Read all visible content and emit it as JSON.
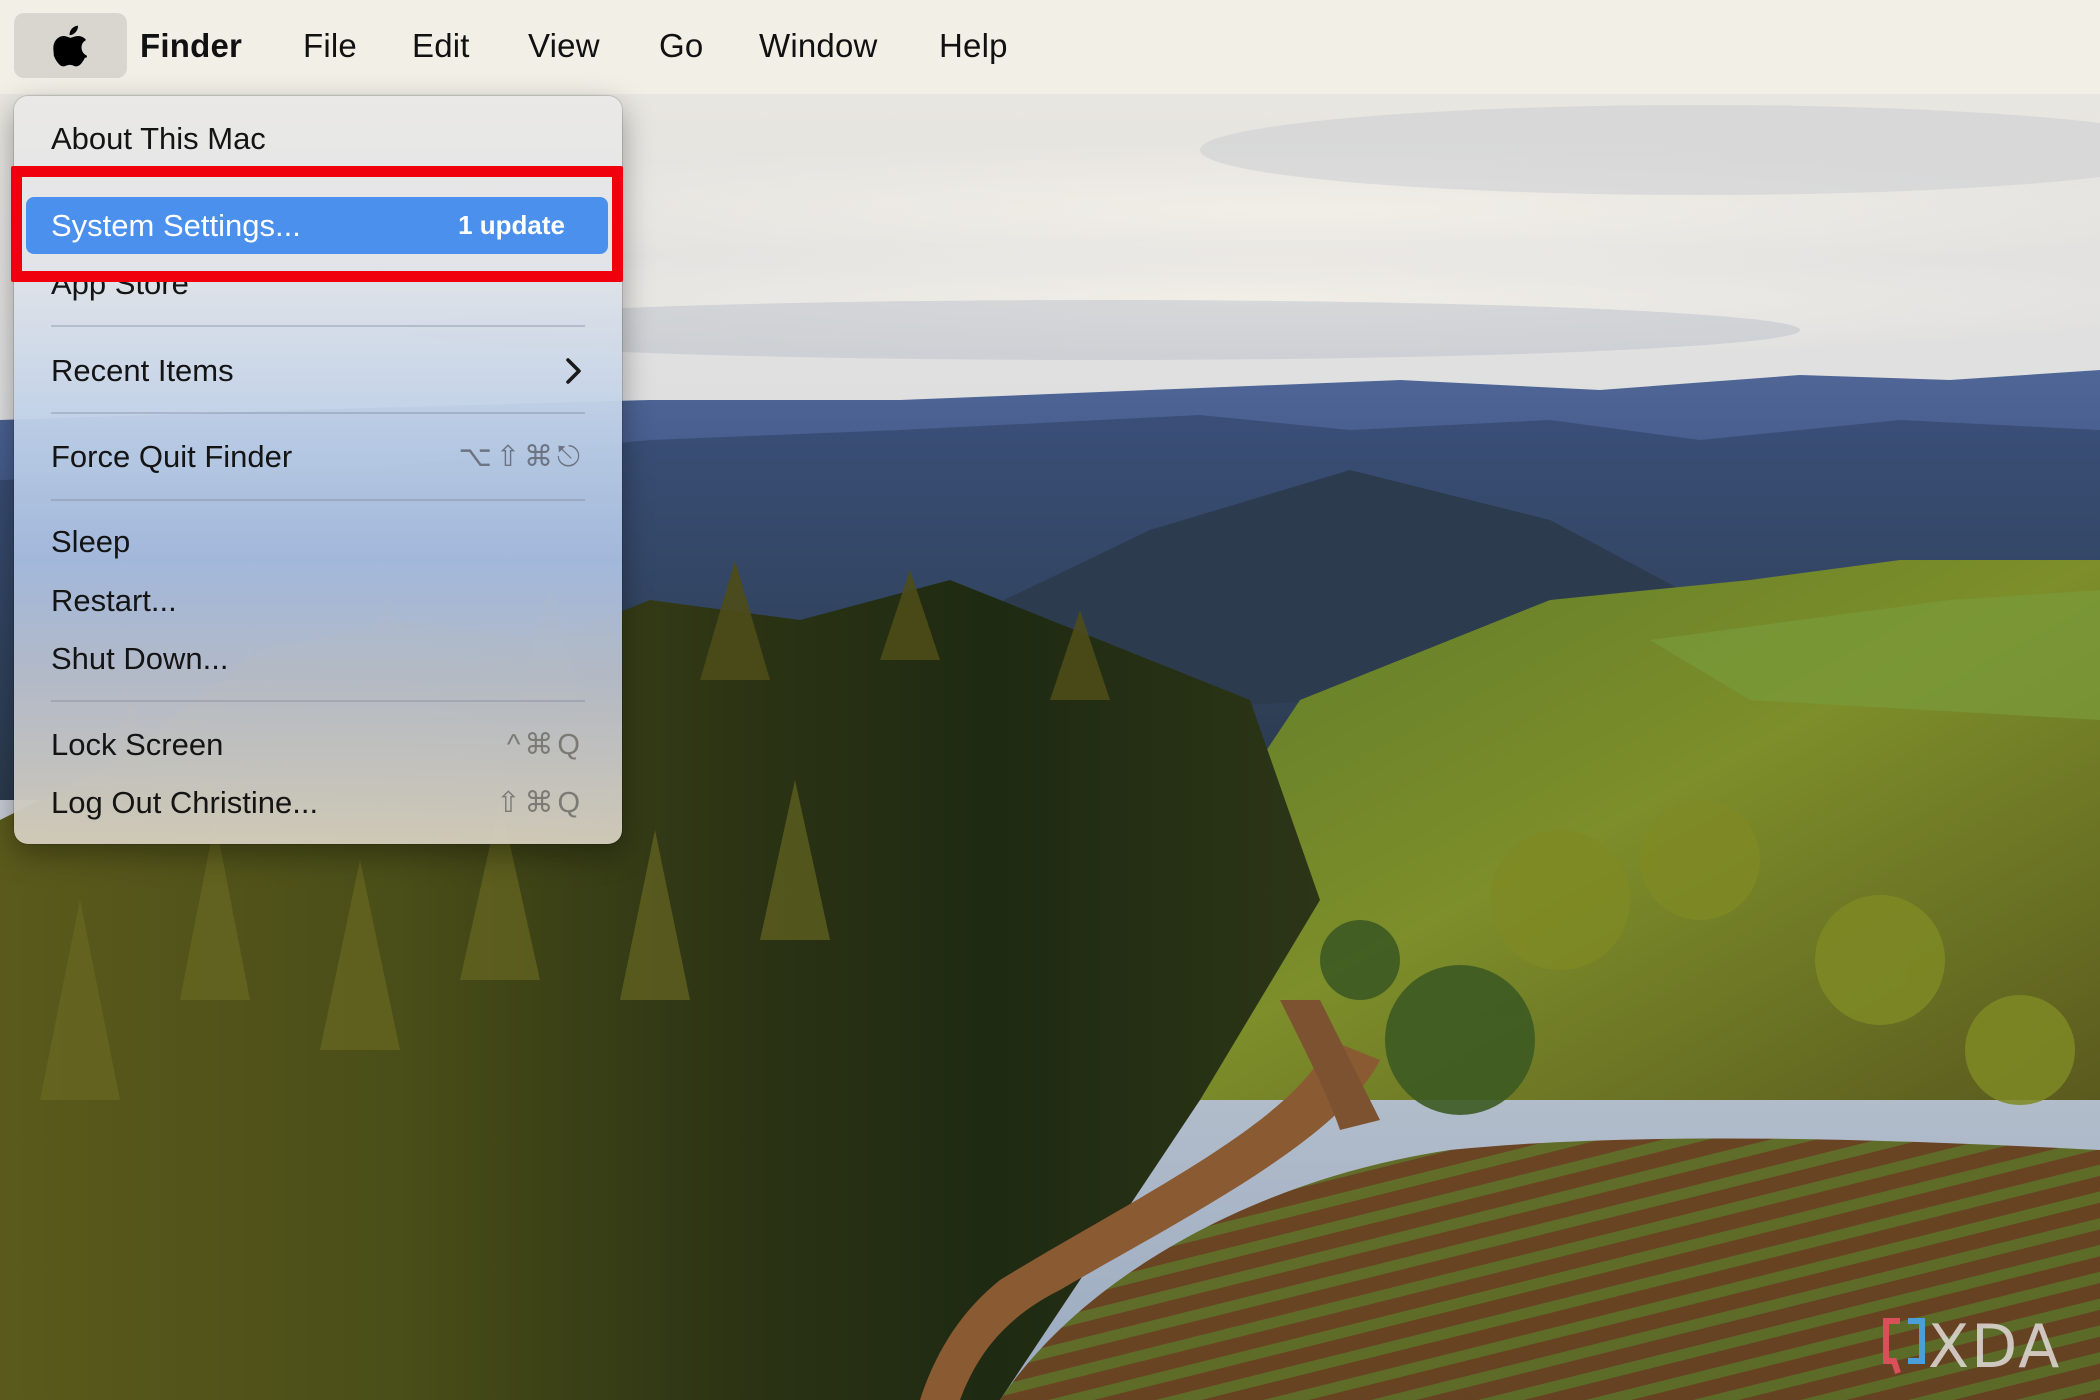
{
  "menubar": {
    "apple_icon": "apple-logo-icon",
    "app_name": "Finder",
    "items": [
      "File",
      "Edit",
      "View",
      "Go",
      "Window",
      "Help"
    ]
  },
  "apple_menu": {
    "items": [
      {
        "label": "About This Mac"
      },
      {
        "label": "System Settings...",
        "badge": "1 update",
        "highlighted": true
      },
      {
        "label": "App Store"
      },
      {
        "label": "Recent Items",
        "submenu_icon": "chevron-right-icon"
      },
      {
        "label": "Force Quit Finder",
        "shortcut": "⌥⇧⌘⎋"
      },
      {
        "label": "Sleep"
      },
      {
        "label": "Restart..."
      },
      {
        "label": "Shut Down..."
      },
      {
        "label": "Lock Screen",
        "shortcut": "^⌘Q"
      },
      {
        "label": "Log Out Christine...",
        "shortcut": "⇧⌘Q"
      }
    ]
  },
  "annotation": {
    "type": "highlight-box",
    "color": "#f0000c",
    "target": "System Settings..."
  },
  "colors": {
    "highlight": "#4a90ec",
    "menubar_bg": "#f1eee6"
  },
  "watermark": {
    "text": "XDA"
  }
}
